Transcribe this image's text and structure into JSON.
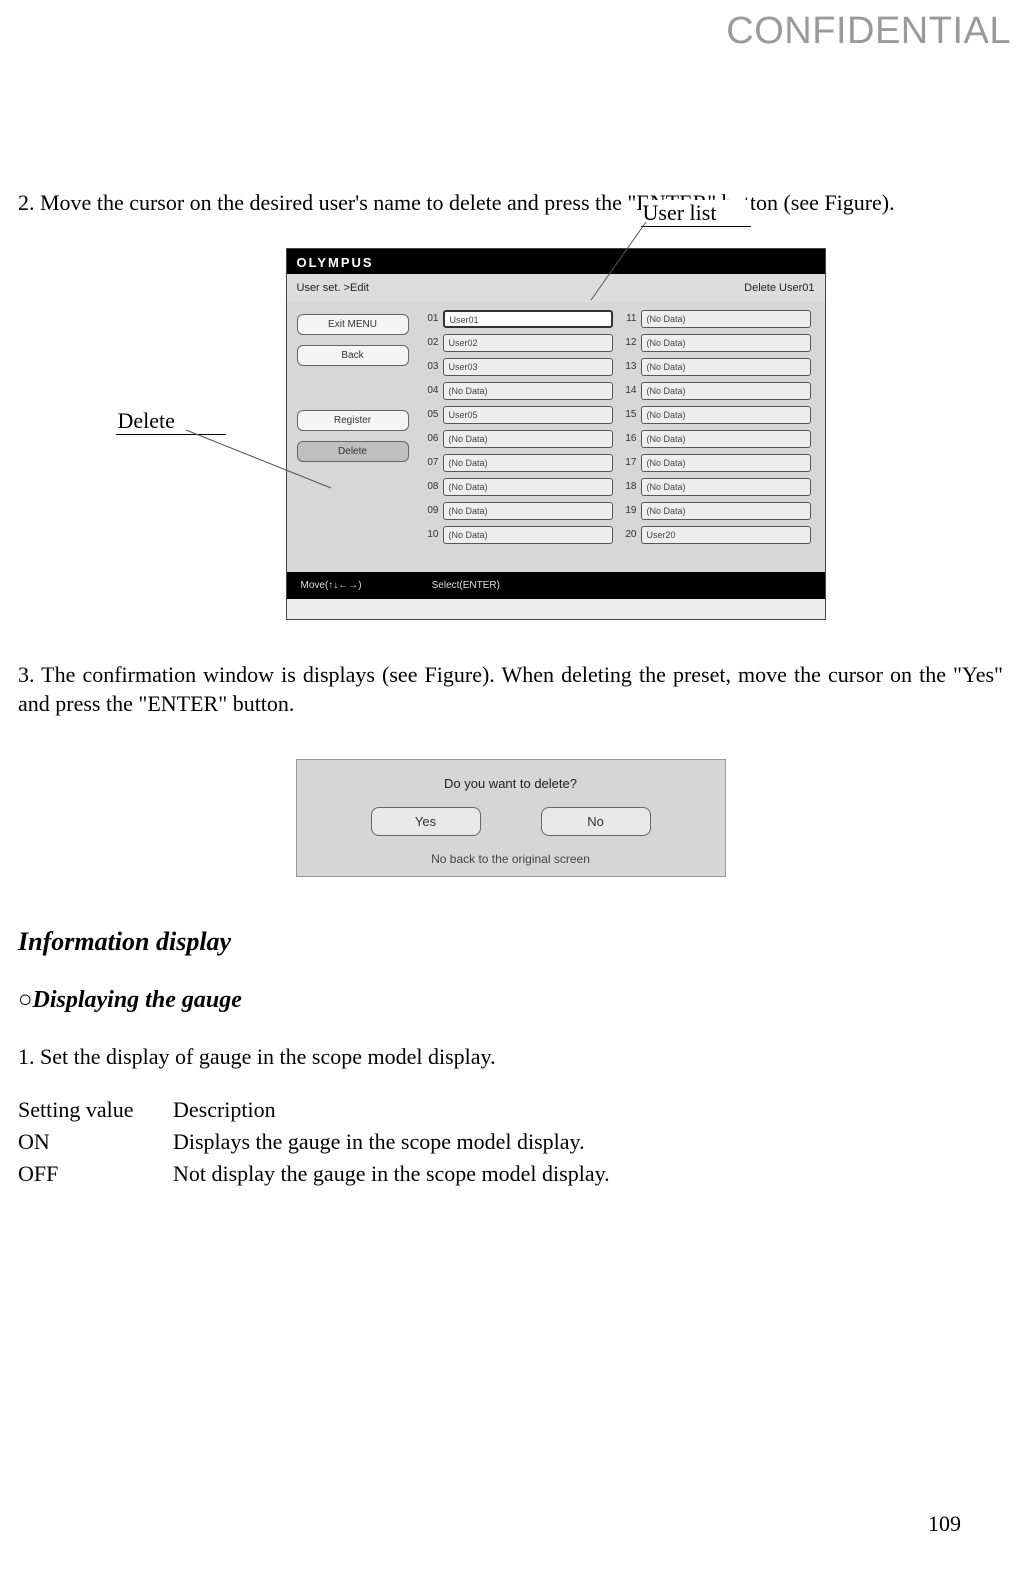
{
  "watermark": "CONFIDENTIAL",
  "para1": "2. Move the cursor on the desired user's name to delete and press the \"ENTER\" button (see Figure).",
  "callouts": {
    "userlist": "User list",
    "delete": "Delete"
  },
  "screen1": {
    "brand": "OLYMPUS",
    "breadcrumb": "User set. >Edit",
    "status": "Delete User01",
    "menu": {
      "exit": "Exit MENU",
      "back": "Back",
      "register": "Register",
      "delete": "Delete"
    },
    "col1": [
      {
        "n": "01",
        "v": "User01"
      },
      {
        "n": "02",
        "v": "User02"
      },
      {
        "n": "03",
        "v": "User03"
      },
      {
        "n": "04",
        "v": "(No Data)"
      },
      {
        "n": "05",
        "v": "User05"
      },
      {
        "n": "06",
        "v": "(No Data)"
      },
      {
        "n": "07",
        "v": "(No Data)"
      },
      {
        "n": "08",
        "v": "(No Data)"
      },
      {
        "n": "09",
        "v": "(No Data)"
      },
      {
        "n": "10",
        "v": "(No Data)"
      }
    ],
    "col2": [
      {
        "n": "11",
        "v": "(No Data)"
      },
      {
        "n": "12",
        "v": "(No Data)"
      },
      {
        "n": "13",
        "v": "(No Data)"
      },
      {
        "n": "14",
        "v": "(No Data)"
      },
      {
        "n": "15",
        "v": "(No Data)"
      },
      {
        "n": "16",
        "v": "(No Data)"
      },
      {
        "n": "17",
        "v": "(No Data)"
      },
      {
        "n": "18",
        "v": "(No Data)"
      },
      {
        "n": "19",
        "v": "(No Data)"
      },
      {
        "n": "20",
        "v": "User20"
      }
    ],
    "footer_move": "Move(↑↓←→)",
    "footer_select": "Select(ENTER)"
  },
  "para2": "3. The confirmation window is displays (see Figure). When deleting the preset, move the cursor on the \"Yes\" and press the \"ENTER\" button.",
  "dialog": {
    "question": "Do you want to delete?",
    "yes": "Yes",
    "no": "No",
    "note": "No back to the original screen"
  },
  "h_section": "Information display",
  "h_sub": "○Displaying the gauge",
  "para3": "1. Set the display of gauge in the scope model display.",
  "table": {
    "h1": "Setting value",
    "h2": "Description",
    "rows": [
      {
        "k": "ON",
        "v": "Displays the gauge in the scope model display."
      },
      {
        "k": "OFF",
        "v": "Not display the gauge in the scope model display."
      }
    ]
  },
  "page_num": "109"
}
